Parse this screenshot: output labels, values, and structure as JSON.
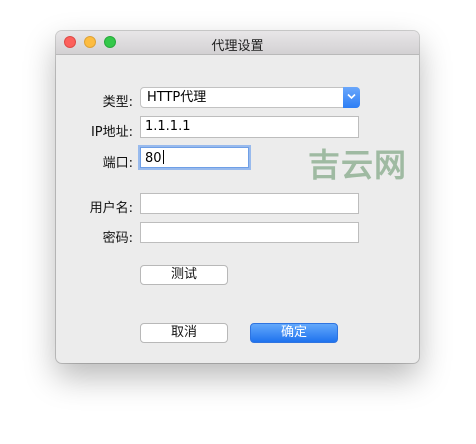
{
  "window": {
    "title": "代理设置"
  },
  "form": {
    "type_label": "类型:",
    "type_value": "HTTP代理",
    "ip_label": "IP地址:",
    "ip_value": "1.1.1.1",
    "port_label": "端口:",
    "port_value": "80",
    "username_label": "用户名:",
    "username_value": "",
    "password_label": "密码:",
    "password_value": ""
  },
  "buttons": {
    "test": "测试",
    "cancel": "取消",
    "ok": "确定"
  },
  "watermark": "吉云网",
  "colors": {
    "accent": "#2d7ef5",
    "close": "#fc605c",
    "minimize": "#fdbc40",
    "maximize": "#34c84a"
  }
}
